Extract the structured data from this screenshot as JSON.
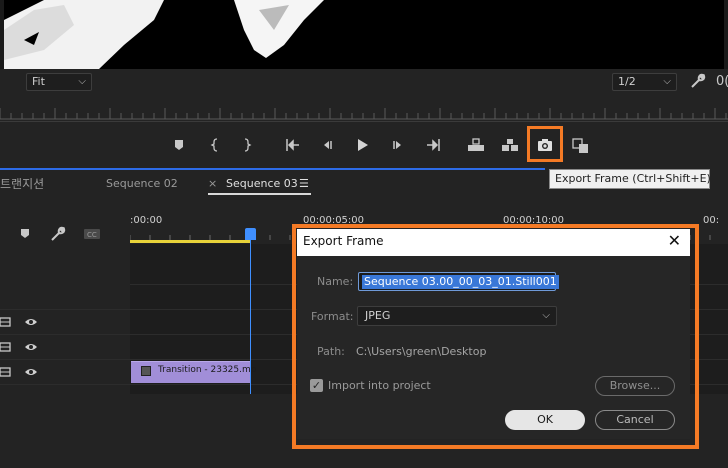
{
  "monitor": {
    "zoom_label": "Fit",
    "resolution_label": "1/2",
    "timecode_peek": "0("
  },
  "transport": {
    "buttons": [
      "add-marker",
      "mark-in",
      "mark-out",
      "go-to-in",
      "step-back",
      "play",
      "step-forward",
      "go-to-out",
      "lift",
      "extract",
      "export-frame",
      "comparison-view"
    ]
  },
  "tooltip": {
    "text": "Export Frame (Ctrl+Shift+E)"
  },
  "timeline": {
    "panel_tab": "트랜지션",
    "tabs": [
      {
        "label": "Sequence 02"
      },
      {
        "label": "Sequence 03",
        "close": "×",
        "menu": "☰"
      }
    ],
    "times": [
      ":00:00",
      "00:00:05:00",
      "00:00:10:00",
      "00:"
    ],
    "clip": {
      "label": "Transition - 23325.mp"
    }
  },
  "dialog": {
    "title": "Export Frame",
    "close": "✕",
    "name_label": "Name:",
    "name_value": "Sequence 03.00_00_03_01.Still001",
    "format_label": "Format:",
    "format_value": "JPEG",
    "path_label": "Path:",
    "path_value": "C:\\Users\\green\\Desktop",
    "import_label": "Import into project",
    "import_checked": "✓",
    "browse_label": "Browse...",
    "ok_label": "OK",
    "cancel_label": "Cancel"
  },
  "colors": {
    "highlight": "#f47a25",
    "playhead": "#3f8fff",
    "clip": "#a18ed8"
  }
}
